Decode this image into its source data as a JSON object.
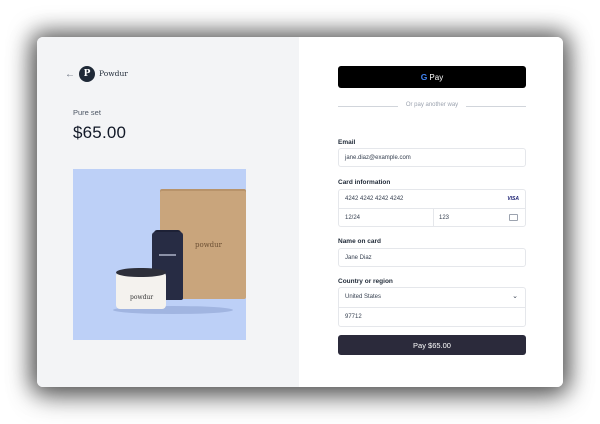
{
  "brand": {
    "name": "Powdur",
    "logo_letter": "P"
  },
  "product": {
    "name": "Pure set",
    "price": "$65.00",
    "box_label": "powdur",
    "jar_label": "powdur"
  },
  "gpay": {
    "label": "Pay",
    "g": "G"
  },
  "divider": {
    "text": "Or pay another way"
  },
  "email": {
    "label": "Email",
    "value": "jane.diaz@example.com"
  },
  "card": {
    "label": "Card information",
    "number": "4242 4242 4242 4242",
    "brand": "VISA",
    "expiry": "12/24",
    "cvc": "123"
  },
  "name_on_card": {
    "label": "Name on card",
    "value": "Jane Diaz"
  },
  "country": {
    "label": "Country or region",
    "value": "United States",
    "zip": "97712"
  },
  "pay_button": {
    "label": "Pay $65.00"
  },
  "colors": {
    "pay_button": "#2b2a3b",
    "gpay_button": "#000000",
    "left_panel": "#f3f4f6",
    "product_bg": "#bdd0f7"
  }
}
